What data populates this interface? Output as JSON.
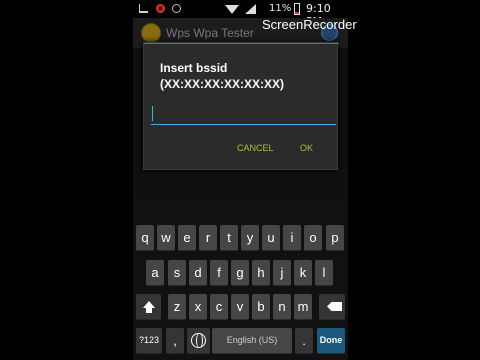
{
  "status_bar": {
    "battery_percent": "11%",
    "time": "9:10 PM"
  },
  "overlay": {
    "screen_recorder_label": "ScreenRecorder"
  },
  "app": {
    "title": "Wps Wpa Tester"
  },
  "dialog": {
    "message_line1": "Insert bssid",
    "message_line2": "(XX:XX:XX:XX:XX:XX)",
    "input_value": "",
    "cancel_label": "CANCEL",
    "ok_label": "OK"
  },
  "keyboard": {
    "row1": [
      "q",
      "w",
      "e",
      "r",
      "t",
      "y",
      "u",
      "i",
      "o",
      "p"
    ],
    "row2": [
      "a",
      "s",
      "d",
      "f",
      "g",
      "h",
      "j",
      "k",
      "l"
    ],
    "row3": [
      "z",
      "x",
      "c",
      "v",
      "b",
      "n",
      "m"
    ],
    "key_123": "?123",
    "key_comma": ",",
    "key_space": "English (US)",
    "key_period": ".",
    "key_done": "Done"
  },
  "colors": {
    "accent": "#33b5e5",
    "button_text": "#a6c03a",
    "done_key": "#1b5a7e"
  }
}
